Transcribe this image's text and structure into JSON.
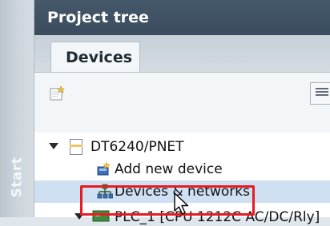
{
  "sidebar": {
    "start_label": "Start"
  },
  "panel": {
    "title": "Project tree",
    "tabs": [
      {
        "label": "Devices",
        "active": true
      }
    ]
  },
  "toolbar": {
    "buttons": [
      {
        "icon": "new-item-icon"
      },
      {
        "icon": "list-view-icon"
      }
    ]
  },
  "tree": {
    "items": [
      {
        "label": "DT6240/PNET",
        "icon": "project-document-icon",
        "expanded": true
      },
      {
        "label": "Add new device",
        "icon": "add-device-icon"
      },
      {
        "label": "Devices & networks",
        "icon": "network-icon",
        "selected": true,
        "highlighted": true
      },
      {
        "label": "PLC_1 [CPU 1212C AC/DC/Rly]",
        "icon": "plc-icon",
        "expanded": true
      }
    ]
  },
  "colors": {
    "title_bar": "#3a4c5d",
    "selection": "#cfe0f2",
    "highlight_box": "#e81b23"
  }
}
